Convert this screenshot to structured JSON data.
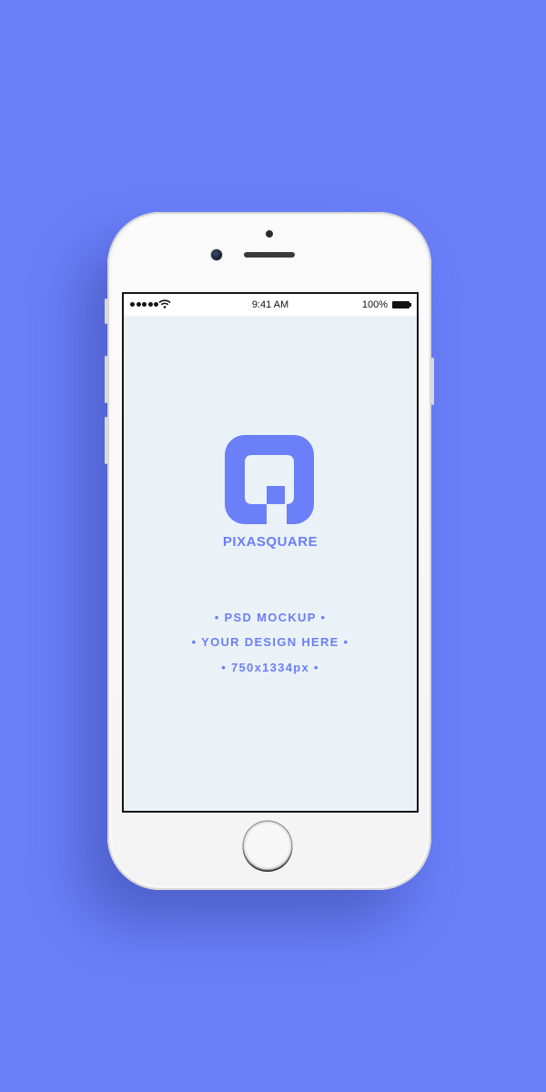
{
  "colors": {
    "background": "#6a7ff8",
    "accent": "#6a7ff8",
    "screen_background": "#ebf2f7"
  },
  "status_bar": {
    "time": "9:41 AM",
    "battery": "100%",
    "icons": [
      "signal-dots-icon",
      "wifi-icon",
      "battery-icon"
    ]
  },
  "screen": {
    "logo_icon": "pixasquare-logo-icon",
    "brand": "PIXASQUARE",
    "lines": [
      "• PSD MOCKUP •",
      "• YOUR DESIGN HERE •",
      "• 750x1334px •"
    ]
  }
}
